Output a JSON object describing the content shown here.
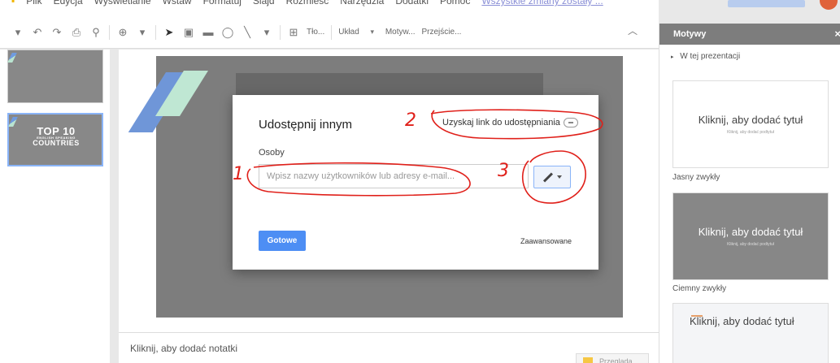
{
  "menubar": {
    "items": [
      "Plik",
      "Edycja",
      "Wyświetlanie",
      "Wstaw",
      "Formatuj",
      "Slajd",
      "Rozmieść",
      "Narzędzia",
      "Dodatki",
      "Pomoc"
    ],
    "status": "Wszystkie zmiany zostały ..."
  },
  "toolbar": {
    "background_label": "Tło...",
    "layout_label": "Układ",
    "theme_label": "Motyw...",
    "transition_label": "Przejście..."
  },
  "filmstrip": {
    "slide2_logo": "TOP 10",
    "slide2_sub1": "ENGLISH SPEAKING",
    "slide2_sub2": "COUNTRIES"
  },
  "notes": {
    "placeholder": "Kliknij, aby dodać notatki"
  },
  "explore": {
    "label": "Przegląda..."
  },
  "dialog": {
    "title": "Udostępnij innym",
    "link_label": "Uzyskaj link do udostępniania",
    "people_label": "Osoby",
    "people_placeholder": "Wpisz nazwy użytkowników lub adresy e-mail...",
    "done_label": "Gotowe",
    "advanced_label": "Zaawansowane"
  },
  "annotations": {
    "n1": "1",
    "n2": "2",
    "n3": "3",
    "color": "#e0201a"
  },
  "sidebar": {
    "title": "Motywy",
    "close": "×",
    "section": "W tej prezentacji",
    "themes": [
      {
        "title": "Kliknij, aby dodać tytuł",
        "subtitle": "Kliknij, aby dodać podtytuł",
        "name": "Jasny zwykły"
      },
      {
        "title": "Kliknij, aby dodać tytuł",
        "subtitle": "Kliknij, aby dodać podtytuł",
        "name": "Ciemny zwykły"
      },
      {
        "title": "Kliknij, aby dodać tytuł"
      }
    ]
  },
  "colors": {
    "accent_blue": "#4d8ef4",
    "sidebar_header": "#7d7d7d",
    "slide_bg": "#7d7d7d"
  }
}
